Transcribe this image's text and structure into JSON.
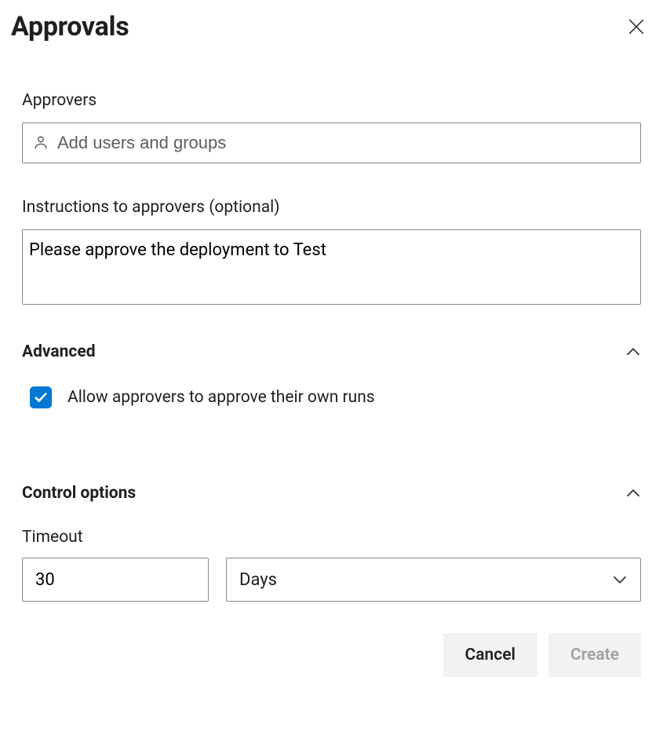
{
  "header": {
    "title": "Approvals"
  },
  "approvers": {
    "label": "Approvers",
    "placeholder": "Add users and groups",
    "value": ""
  },
  "instructions": {
    "label": "Instructions to approvers (optional)",
    "value": "Please approve the deployment to Test"
  },
  "advanced": {
    "title": "Advanced",
    "expanded": true,
    "allow_own_runs": {
      "checked": true,
      "label": "Allow approvers to approve their own runs"
    }
  },
  "control_options": {
    "title": "Control options",
    "expanded": true,
    "timeout": {
      "label": "Timeout",
      "value": "30",
      "unit": "Days"
    }
  },
  "footer": {
    "cancel_label": "Cancel",
    "create_label": "Create",
    "create_enabled": false
  },
  "colors": {
    "accent": "#0078d4",
    "border": "#8a8886",
    "text": "#201f1e",
    "muted": "#605e5c",
    "surface": "#f3f2f1"
  }
}
